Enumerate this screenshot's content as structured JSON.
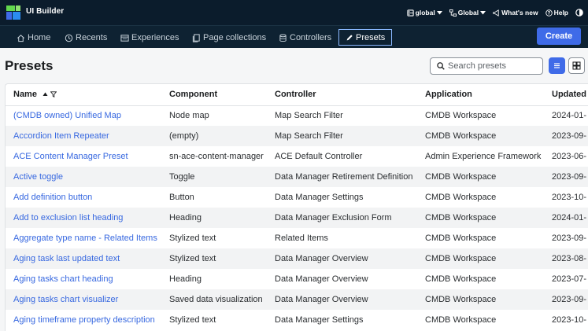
{
  "app": {
    "title": "UI Builder",
    "accent": "#3f6be8",
    "topbar_bg": "#0b1c2c",
    "link_color": "#3768e0"
  },
  "topbar": {
    "scope_label": "global",
    "scope_icon": "database-icon",
    "app_scope_label": "Global",
    "app_scope_icon": "sitemap-icon",
    "whats_new_label": "What's new",
    "whats_new_icon": "megaphone-icon",
    "help_label": "Help",
    "help_icon": "help-circle-icon",
    "theme_icon": "contrast-icon"
  },
  "nav": {
    "items": [
      {
        "label": "Home",
        "icon": "home-icon"
      },
      {
        "label": "Recents",
        "icon": "history-icon"
      },
      {
        "label": "Experiences",
        "icon": "window-icon"
      },
      {
        "label": "Page collections",
        "icon": "pages-icon"
      },
      {
        "label": "Controllers",
        "icon": "database-icon"
      },
      {
        "label": "Presets",
        "icon": "pencil-icon",
        "active": true
      }
    ],
    "create_label": "Create"
  },
  "page": {
    "title": "Presets",
    "search_placeholder": "Search presets",
    "view_mode": "list"
  },
  "table": {
    "columns": [
      "Name",
      "Component",
      "Controller",
      "Application",
      "Updated"
    ],
    "sorted_column": "Name",
    "sort_direction": "ascending",
    "rows": [
      {
        "name": "(CMDB owned) Unified Map",
        "component": "Node map",
        "controller": "Map Search Filter",
        "application": "CMDB Workspace",
        "updated": "2024-01-"
      },
      {
        "name": "Accordion Item Repeater",
        "component": "(empty)",
        "controller": "Map Search Filter",
        "application": "CMDB Workspace",
        "updated": "2023-09-"
      },
      {
        "name": "ACE Content Manager Preset",
        "component": "sn-ace-content-manager",
        "controller": "ACE Default Controller",
        "application": "Admin Experience Framework",
        "updated": "2023-06-"
      },
      {
        "name": "Active toggle",
        "component": "Toggle",
        "controller": "Data Manager Retirement Definition",
        "application": "CMDB Workspace",
        "updated": "2023-09-"
      },
      {
        "name": "Add definition button",
        "component": "Button",
        "controller": "Data Manager Settings",
        "application": "CMDB Workspace",
        "updated": "2023-10-"
      },
      {
        "name": "Add to exclusion list heading",
        "component": "Heading",
        "controller": "Data Manager Exclusion Form",
        "application": "CMDB Workspace",
        "updated": "2024-01-"
      },
      {
        "name": "Aggregate type name - Related Items",
        "component": "Stylized text",
        "controller": "Related Items",
        "application": "CMDB Workspace",
        "updated": "2023-09-"
      },
      {
        "name": "Aging task last updated text",
        "component": "Stylized text",
        "controller": "Data Manager Overview",
        "application": "CMDB Workspace",
        "updated": "2023-08-"
      },
      {
        "name": "Aging tasks chart heading",
        "component": "Heading",
        "controller": "Data Manager Overview",
        "application": "CMDB Workspace",
        "updated": "2023-07-"
      },
      {
        "name": "Aging tasks chart visualizer",
        "component": "Saved data visualization",
        "controller": "Data Manager Overview",
        "application": "CMDB Workspace",
        "updated": "2023-09-"
      },
      {
        "name": "Aging timeframe property description",
        "component": "Stylized text",
        "controller": "Data Manager Settings",
        "application": "CMDB Workspace",
        "updated": "2023-10-"
      }
    ]
  }
}
